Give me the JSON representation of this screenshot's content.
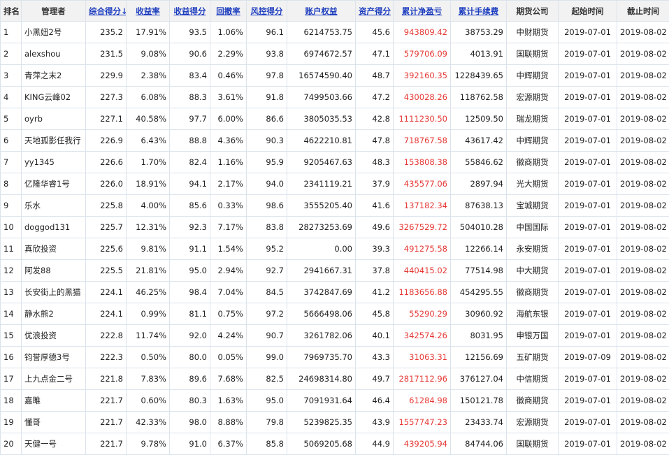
{
  "headers": [
    "排名",
    "管理者",
    "综合得分↓",
    "收益率",
    "收益得分",
    "回撤率",
    "风控得分",
    "账户权益",
    "资产得分",
    "累计净盈亏",
    "累计手续费",
    "期货公司",
    "起始时间",
    "截止时间"
  ],
  "sortable": [
    false,
    false,
    true,
    true,
    true,
    true,
    true,
    true,
    true,
    true,
    true,
    false,
    false,
    false
  ],
  "colors": {
    "header_bg": "#f2f2f2",
    "link": "#1f3fbf",
    "loss_gain_red": "#e53935",
    "border": "#dbe3ec"
  },
  "rows": [
    [
      "1",
      "小黑妞2号",
      "235.2",
      "17.91%",
      "93.5",
      "1.06%",
      "96.1",
      "6214753.75",
      "45.6",
      "943809.42",
      "38753.29",
      "中财期货",
      "2019-07-01",
      "2019-08-02"
    ],
    [
      "2",
      "alexshou",
      "231.5",
      "9.08%",
      "90.6",
      "2.29%",
      "93.8",
      "6974672.57",
      "47.1",
      "579706.09",
      "4013.91",
      "国联期货",
      "2019-07-01",
      "2019-08-02"
    ],
    [
      "3",
      "青萍之末2",
      "229.9",
      "2.38%",
      "83.4",
      "0.46%",
      "97.8",
      "16574590.40",
      "48.7",
      "392160.35",
      "1228439.65",
      "中辉期货",
      "2019-07-01",
      "2019-08-02"
    ],
    [
      "4",
      "KING云峰02",
      "227.3",
      "6.08%",
      "88.3",
      "3.61%",
      "91.8",
      "7499503.66",
      "47.2",
      "430028.26",
      "118762.58",
      "宏源期货",
      "2019-07-01",
      "2019-08-02"
    ],
    [
      "5",
      "oyrb",
      "227.1",
      "40.58%",
      "97.7",
      "6.00%",
      "86.6",
      "3805035.53",
      "42.8",
      "1111230.50",
      "12509.50",
      "瑞龙期货",
      "2019-07-01",
      "2019-08-02"
    ],
    [
      "6",
      "天地孤影任我行",
      "226.9",
      "6.43%",
      "88.8",
      "4.36%",
      "90.3",
      "4622210.81",
      "47.8",
      "718767.58",
      "43617.42",
      "中辉期货",
      "2019-07-01",
      "2019-08-02"
    ],
    [
      "7",
      "yy1345",
      "226.6",
      "1.70%",
      "82.4",
      "1.16%",
      "95.9",
      "9205467.63",
      "48.3",
      "153808.38",
      "55846.62",
      "徽商期货",
      "2019-07-01",
      "2019-08-02"
    ],
    [
      "8",
      "亿隆华睿1号",
      "226.0",
      "18.91%",
      "94.1",
      "2.17%",
      "94.0",
      "2341119.21",
      "37.9",
      "435577.06",
      "2897.94",
      "光大期货",
      "2019-07-01",
      "2019-08-02"
    ],
    [
      "9",
      "乐水",
      "225.8",
      "4.00%",
      "85.6",
      "0.33%",
      "98.6",
      "3555205.40",
      "41.6",
      "137182.34",
      "87638.13",
      "宝城期货",
      "2019-07-01",
      "2019-08-02"
    ],
    [
      "10",
      "doggod131",
      "225.7",
      "12.31%",
      "92.3",
      "7.17%",
      "83.8",
      "28273253.69",
      "49.6",
      "3267529.72",
      "504010.28",
      "中国国际",
      "2019-07-01",
      "2019-08-02"
    ],
    [
      "11",
      "真欣投资",
      "225.6",
      "9.81%",
      "91.1",
      "1.54%",
      "95.2",
      "0.00",
      "39.3",
      "491275.58",
      "12266.14",
      "永安期货",
      "2019-07-01",
      "2019-08-02"
    ],
    [
      "12",
      "阿发88",
      "225.5",
      "21.81%",
      "95.0",
      "2.94%",
      "92.7",
      "2941667.31",
      "37.8",
      "440415.02",
      "77514.98",
      "中大期货",
      "2019-07-01",
      "2019-08-02"
    ],
    [
      "13",
      "长安街上的黑猫",
      "224.1",
      "46.25%",
      "98.4",
      "7.04%",
      "84.5",
      "3742847.69",
      "41.2",
      "1183656.88",
      "454295.55",
      "徽商期货",
      "2019-07-01",
      "2019-08-02"
    ],
    [
      "14",
      "静水熊2",
      "224.1",
      "0.99%",
      "81.1",
      "0.75%",
      "97.2",
      "5666498.06",
      "45.8",
      "55290.29",
      "30960.92",
      "海航东银",
      "2019-07-01",
      "2019-08-02"
    ],
    [
      "15",
      "优浪投资",
      "222.8",
      "11.74%",
      "92.0",
      "4.24%",
      "90.7",
      "3261782.06",
      "40.1",
      "342574.26",
      "8031.95",
      "申银万国",
      "2019-07-01",
      "2019-08-02"
    ],
    [
      "16",
      "钧誉厚德3号",
      "222.3",
      "0.50%",
      "80.0",
      "0.05%",
      "99.0",
      "7969735.70",
      "43.3",
      "31063.31",
      "12156.69",
      "五矿期货",
      "2019-07-09",
      "2019-08-02"
    ],
    [
      "17",
      "上九点金二号",
      "221.8",
      "7.83%",
      "89.6",
      "7.68%",
      "82.5",
      "24698314.80",
      "49.7",
      "2817112.96",
      "376127.04",
      "中信期货",
      "2019-07-01",
      "2019-08-02"
    ],
    [
      "18",
      "嘉雎",
      "221.7",
      "0.60%",
      "80.3",
      "1.63%",
      "95.0",
      "7091931.64",
      "46.4",
      "61284.98",
      "150121.78",
      "徽商期货",
      "2019-07-01",
      "2019-08-02"
    ],
    [
      "19",
      "懂哥",
      "221.7",
      "42.33%",
      "98.0",
      "8.88%",
      "79.8",
      "5239825.35",
      "43.9",
      "1557747.23",
      "23433.74",
      "宏源期货",
      "2019-07-01",
      "2019-08-02"
    ],
    [
      "20",
      "天健一号",
      "221.7",
      "9.78%",
      "91.0",
      "6.37%",
      "85.8",
      "5069205.68",
      "44.9",
      "439205.94",
      "84744.06",
      "国联期货",
      "2019-07-01",
      "2019-08-02"
    ]
  ]
}
